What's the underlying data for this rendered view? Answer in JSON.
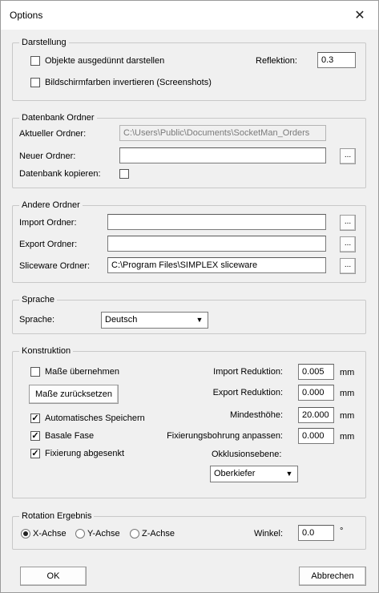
{
  "window": {
    "title": "Options",
    "close_glyph": "✕"
  },
  "darstellung": {
    "legend": "Darstellung",
    "thin_objects": {
      "label": "Objekte ausgedünnt darstellen",
      "checked": false
    },
    "invert_colors": {
      "label": "Bildschirmfarben invertieren (Screenshots)",
      "checked": false
    },
    "reflection_label": "Reflektion:",
    "reflection_value": "0.3"
  },
  "datenbank": {
    "legend": "Datenbank Ordner",
    "current_label": "Aktueller Ordner:",
    "current_value": "C:\\Users\\Public\\Documents\\SocketMan_Orders",
    "new_label": "Neuer Ordner:",
    "new_value": "",
    "copy_label": "Datenbank kopieren:",
    "copy_checked": false,
    "browse_label": "..."
  },
  "andere": {
    "legend": "Andere Ordner",
    "import_label": "Import Ordner:",
    "import_value": "",
    "export_label": "Export Ordner:",
    "export_value": "",
    "sliceware_label": "Sliceware Ordner:",
    "sliceware_value": "C:\\Program Files\\SIMPLEX sliceware",
    "browse_label": "..."
  },
  "sprache": {
    "legend": "Sprache",
    "label": "Sprache:",
    "value": "Deutsch",
    "arrow": "▼"
  },
  "konstruktion": {
    "legend": "Konstruktion",
    "masse_label": "Maße übernehmen",
    "masse_checked": false,
    "reset_button": "Maße zurücksetzen",
    "autosave_label": "Automatisches Speichern",
    "autosave_checked": true,
    "basale_label": "Basale Fase",
    "basale_checked": true,
    "fixierung_label": "Fixierung abgesenkt",
    "fixierung_checked": true,
    "import_red_label": "Import Reduktion:",
    "import_red_value": "0.005",
    "export_red_label": "Export Reduktion:",
    "export_red_value": "0.000",
    "min_height_label": "Mindesthöhe:",
    "min_height_value": "20.000",
    "bohrung_label": "Fixierungsbohrung anpassen:",
    "bohrung_value": "0.000",
    "unit": "mm",
    "okklusion_label": "Okklusionsebene:",
    "okklusion_value": "Oberkiefer",
    "arrow": "▼"
  },
  "rotation": {
    "legend": "Rotation Ergebnis",
    "x_label": "X-Achse",
    "y_label": "Y-Achse",
    "z_label": "Z-Achse",
    "selected": "X-Achse",
    "winkel_label": "Winkel:",
    "winkel_value": "0.0",
    "winkel_unit": "°"
  },
  "buttons": {
    "ok": "OK",
    "cancel": "Abbrechen"
  }
}
